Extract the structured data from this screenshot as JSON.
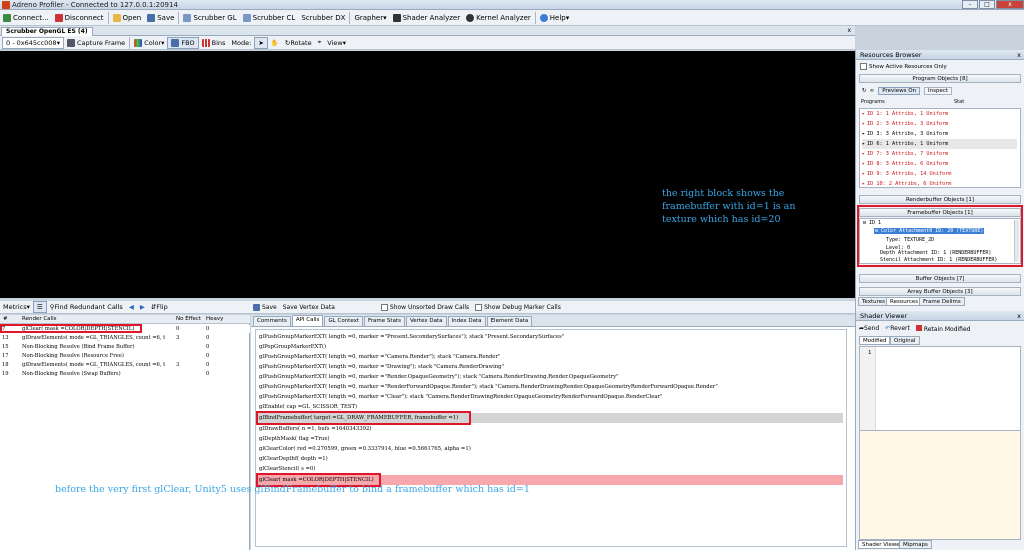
{
  "window": {
    "title": "Adreno Profiler - Connected to 127.0.0.1:20914",
    "controls": [
      "-",
      "□",
      "x"
    ]
  },
  "menubar": {
    "connect": "Connect...",
    "disconnect": "Disconnect",
    "open": "Open",
    "save": "Save",
    "scrubber_gl": "Scrubber GL",
    "scrubber_cl": "Scrubber CL",
    "scrubber_dx": "Scrubber DX",
    "grapher": "Grapher",
    "shader_analyzer": "Shader Analyzer",
    "kernel_analyzer": "Kernel Analyzer",
    "help": "Help"
  },
  "tabs": {
    "scrubber": "Scrubber OpenGL ES (4)",
    "close": "x"
  },
  "scrubber_toolbar": {
    "context": "0 - 0x645cc008",
    "capture_frame": "Capture Frame",
    "color": "Color",
    "fbo": "FBO",
    "bins": "Bins",
    "mode": "Mode:",
    "rotate": "Rotate",
    "view": "View"
  },
  "annotations": {
    "right_block": "the right block shows the\nframebuffer with id=1 is an\ntexture which has id=20",
    "bottom": "before the very first glClear, Unity5 uses glBindFramebuffer to bind a framebuffer which has id=1"
  },
  "metrics_toolbar": {
    "metrics": "Metrics",
    "find_redundant": "Find Redundant Calls",
    "flip": "Flip",
    "save": "Save",
    "save_vertex": "Save Vertex Data"
  },
  "api_toolbar": {
    "show_unsorted": "Show Unsorted Draw Calls",
    "show_debug": "Show Debug Marker Calls"
  },
  "call_grid": {
    "headers": [
      "#",
      "Render Calls",
      "No Effect",
      "Heavy"
    ],
    "rows": [
      {
        "num": "7",
        "call": "glClear( mask =COLOR|DEPTH|STENCIL)",
        "noeffect": "0",
        "heavy": "0"
      },
      {
        "num": "13",
        "call": "glDrawElements( mode =GL_TRIANGLES, count =6, t",
        "noeffect": "3",
        "heavy": "0"
      },
      {
        "num": "15",
        "call": "Non-Blocking Resolve (Bind Frame Buffer)",
        "noeffect": "",
        "heavy": "0"
      },
      {
        "num": "17",
        "call": "Non-Blocking Resolve (Resource Free)",
        "noeffect": "",
        "heavy": "0"
      },
      {
        "num": "18",
        "call": "glDrawElements( mode =GL_TRIANGLES, count =6, t",
        "noeffect": "3",
        "heavy": "0"
      },
      {
        "num": "19",
        "call": "Non-Blocking Resolve (Swap Buffers)",
        "noeffect": "",
        "heavy": "0"
      }
    ]
  },
  "api_tabs": [
    "Comments",
    "API Calls",
    "GL Context",
    "Frame Stats",
    "Vertex Data",
    "Index Data",
    "Element Data"
  ],
  "api_calls": [
    "glPushGroupMarkerEXT( length =0, marker =\"Present.SecondarySurfaces\"); stack \"Present.SecondarySurfaces\"",
    "glPopGroupMarkerEXT()",
    "glPushGroupMarkerEXT( length =0, marker =\"Camera.Render\"); stack \"Camera.Render\"",
    "glPushGroupMarkerEXT( length =0, marker =\"Drawing\"); stack \"Camera.RenderDrawing\"",
    "glPushGroupMarkerEXT( length =0, marker =\"Render.OpaqueGeometry\"); stack \"Camera.RenderDrawing.Render.OpaqueGeometry\"",
    "glPushGroupMarkerEXT( length =0, marker =\"RenderForwardOpaque.Render\"); stack \"Camera.RenderDrawingRender.OpaqueGeometryRenderForwardOpaque.Render\"",
    "glPushGroupMarkerEXT( length =0, marker =\"Clear\"); stack \"Camera.RenderDrawingRender.OpaqueGeometryRenderForwardOpaque.RenderClear\"",
    "glEnable( cap =GL_SCISSOR_TEST)",
    "glBindFramebuffer( target =GL_DRAW_FRAMEBUFFER, framebuffer =1)",
    "glDrawBuffers( n =1, bufs =1640343392)",
    "glDepthMask( flag =True)",
    "glClearColor( red =0.270599, green =0.3337914, blue =0.5661765, alpha =1)",
    "glClearDepthf( depth =1)",
    "glClearStencil( s =0)",
    "glClear( mask =COLOR|DEPTH|STENCIL)"
  ],
  "resources_browser": {
    "title": "Resources Browser",
    "show_active": "Show Active Resources Only",
    "program_objects": "Program Objects [8]",
    "previews_on": "Previews On",
    "inspect": "Inspect",
    "col_programs": "Programs",
    "col_status": "Stat",
    "programs": [
      "ID 1: 1 Attribs, 1 Uniform",
      "ID 2: 3 Attribs, 3 Uniform",
      "ID 3: 3 Attribs, 3 Uniform",
      "ID 6: 1 Attribs, 1 Uniform",
      "ID 7: 3 Attribs, 7 Uniform",
      "ID 8: 3 Attribs, 6 Uniform",
      "ID 9: 3 Attribs, 14 Uniform",
      "ID 10: 2 Attribs, 6 Uniform"
    ],
    "renderbuffer_objects": "Renderbuffer Objects [1]",
    "framebuffer_objects": "Framebuffer Objects [1]",
    "fb_tree": {
      "id": "ID 1",
      "color_attachment": "Color Attachment0 ID: 20 (TEXTURE)",
      "type": "Type: TEXTURE_2D",
      "level": "Level: 0",
      "depth_attachment": "Depth Attachment ID: 1 (RENDERBUFFER)",
      "stencil_attachment": "Stencil Attachment ID: 1 (RENDERBUFFER)"
    },
    "buffer_objects": "Buffer Objects [7]",
    "array_buffer_objects": "Array Buffer Objects [3]",
    "bottom_tabs": [
      "Textures",
      "Resources",
      "Frame Delims"
    ]
  },
  "shader_viewer": {
    "title": "Shader Viewer",
    "send": "Send",
    "revert": "Revert",
    "retain_modified": "Retain Modified",
    "tabs": [
      "Modified",
      "Original"
    ],
    "line_no": "1",
    "bottom_tabs": [
      "Shader Viewer",
      "Mipmaps"
    ]
  },
  "colors": {
    "annotation": "#3aa6e6",
    "highlight_box": "#e0162b",
    "error_text": "#d01010",
    "current_call_bg": "#f6a8ad"
  }
}
